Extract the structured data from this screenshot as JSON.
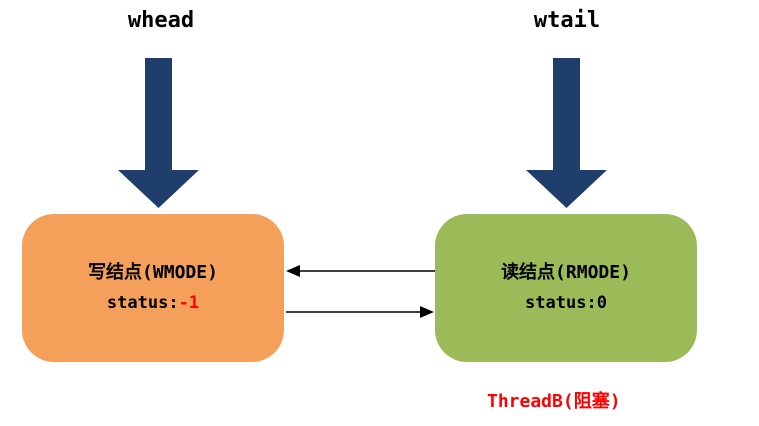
{
  "pointers": {
    "head_label": "whead",
    "tail_label": "wtail"
  },
  "write_node": {
    "title": "写结点(WMODE)",
    "status_label": "status:",
    "status_value": "-1",
    "color": "#f4a05a"
  },
  "read_node": {
    "title": "读结点(RMODE)",
    "status_label": "status:",
    "status_value": "0",
    "color": "#9bbb59"
  },
  "thread_label": "ThreadB(阻塞)",
  "colors": {
    "pointer_arrow": "#1f3e6b",
    "link_arrow": "#000000",
    "thread_text": "#ff0000"
  },
  "icons": {
    "pointer_arrow": "down-arrow-icon",
    "link_arrow": "arrowhead-icon"
  }
}
